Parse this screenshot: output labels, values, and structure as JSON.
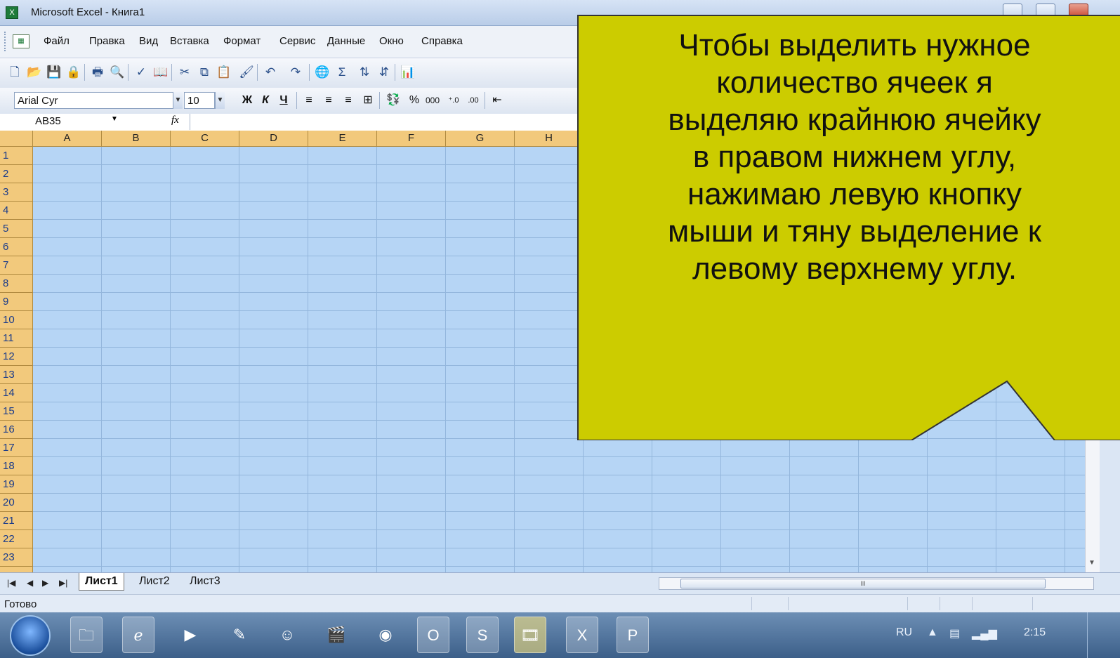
{
  "window": {
    "title": "Microsoft Excel - Книга1"
  },
  "menu": [
    "Файл",
    "Правка",
    "Вид",
    "Вставка",
    "Формат",
    "Сервис",
    "Данные",
    "Окно",
    "Справка"
  ],
  "format_toolbar": {
    "font": "Arial Cyr",
    "size": "10",
    "bold": "Ж",
    "italic": "К",
    "underline": "Ч",
    "percent": "%",
    "thousands": "000"
  },
  "formula_bar": {
    "name_box": "AB35",
    "fx": "fx",
    "formula": ""
  },
  "columns": [
    "A",
    "B",
    "C",
    "D",
    "E",
    "F",
    "G",
    "H"
  ],
  "rows": [
    "1",
    "2",
    "3",
    "4",
    "5",
    "6",
    "7",
    "8",
    "9",
    "10",
    "11",
    "12",
    "13",
    "14",
    "15",
    "16",
    "17",
    "18",
    "19",
    "20",
    "21",
    "22",
    "23"
  ],
  "sheets": [
    "Лист1",
    "Лист2",
    "Лист3"
  ],
  "active_sheet": "Лист1",
  "status": "Готово",
  "taskbar": {
    "lang": "RU",
    "time": "2:15"
  },
  "callout": {
    "lines": [
      "Чтобы выделить нужное",
      "количество ячеек я",
      "выделяю крайнюю ячейку",
      "в правом нижнем углу,",
      "нажимаю левую кнопку",
      "мыши и тяну выделение к",
      "левому верхнему углу."
    ],
    "fill": "#cccc00",
    "border": "#333333"
  },
  "colors": {
    "selection": "#b6d5f5",
    "header": "#f2c97c"
  }
}
